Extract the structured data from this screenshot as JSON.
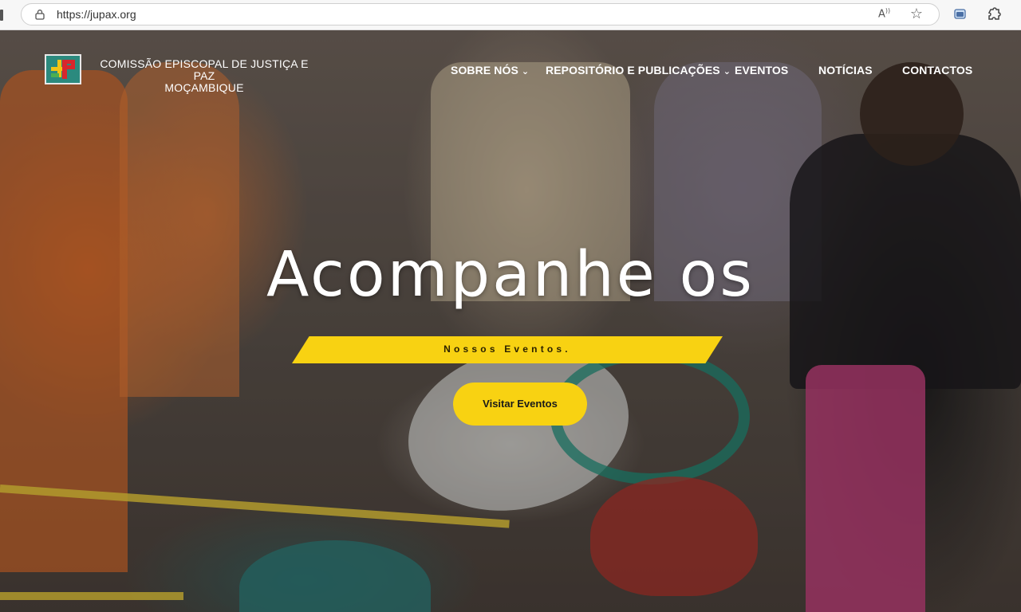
{
  "browser": {
    "url": "https://jupax.org"
  },
  "site": {
    "name_line1": "COMISSÃO EPISCOPAL DE JUSTIÇA E PAZ",
    "name_line2": "MOÇAMBIQUE"
  },
  "nav": {
    "items": [
      {
        "label": "SOBRE NÓS",
        "has_dropdown": true
      },
      {
        "label": "REPOSITÓRIO E PUBLICAÇÕES",
        "has_dropdown": true
      },
      {
        "label": "EVENTOS",
        "has_dropdown": false
      },
      {
        "label": "NOTÍCIAS",
        "has_dropdown": false
      },
      {
        "label": "CONTACTOS",
        "has_dropdown": false
      }
    ]
  },
  "hero": {
    "title": "Acompanhe os",
    "banner": "Nossos Eventos.",
    "cta_label": "Visitar Eventos"
  },
  "colors": {
    "accent": "#f8d212",
    "logo_bg": "#2b8a7e"
  }
}
